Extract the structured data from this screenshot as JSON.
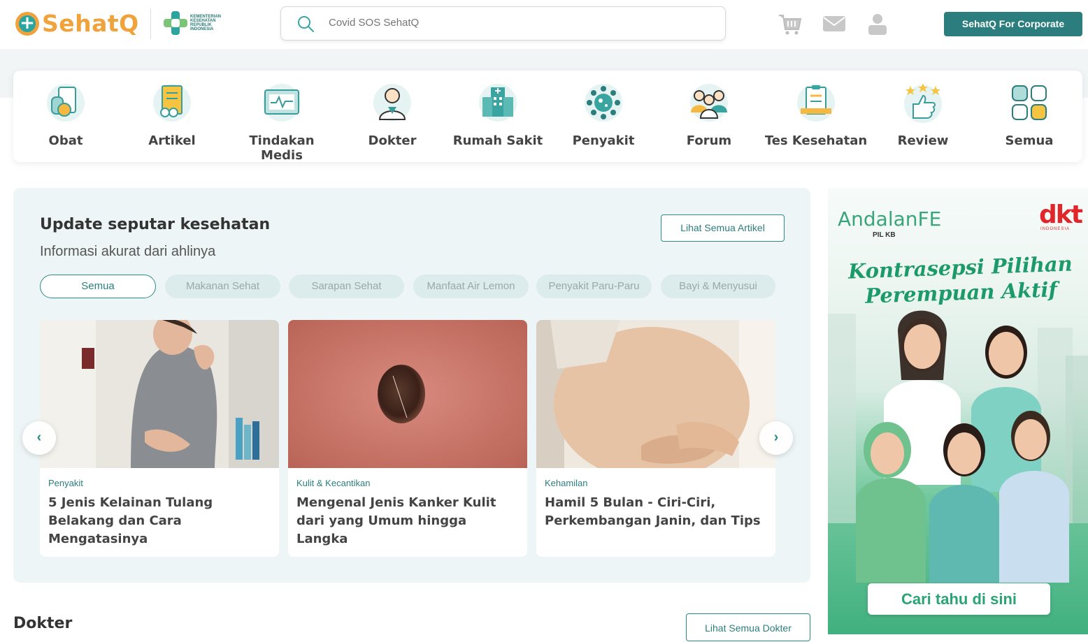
{
  "header": {
    "logo_text": "SehatQ",
    "kemenkes_text": "KEMENTERIAN KESEHATAN REPUBLIK INDONESIA",
    "search_placeholder": "Covid SOS SehatQ",
    "icons": [
      "cart-icon",
      "mail-icon",
      "user-icon"
    ],
    "corporate_button": "SehatQ For Corporate"
  },
  "categories": [
    {
      "label": "Obat",
      "icon": "medicine-icon"
    },
    {
      "label": "Artikel",
      "icon": "article-icon"
    },
    {
      "label": "Tindakan Medis",
      "icon": "medical-procedure-icon"
    },
    {
      "label": "Dokter",
      "icon": "doctor-icon"
    },
    {
      "label": "Rumah Sakit",
      "icon": "hospital-icon"
    },
    {
      "label": "Penyakit",
      "icon": "virus-icon"
    },
    {
      "label": "Forum",
      "icon": "forum-icon"
    },
    {
      "label": "Tes Kesehatan",
      "icon": "health-test-icon"
    },
    {
      "label": "Review",
      "icon": "review-icon"
    },
    {
      "label": "Semua",
      "icon": "grid-icon"
    }
  ],
  "articles": {
    "title": "Update seputar kesehatan",
    "subtitle": "Informasi akurat dari ahlinya",
    "see_all": "Lihat Semua Artikel",
    "chips": [
      "Semua",
      "Makanan Sehat",
      "Sarapan Sehat",
      "Manfaat Air Lemon",
      "Penyakit Paru-Paru",
      "Bayi & Menyusui"
    ],
    "active_chip": "Semua",
    "cards": [
      {
        "category": "Penyakit",
        "title": "5 Jenis Kelainan Tulang Belakang dan Cara Mengatasinya"
      },
      {
        "category": "Kulit & Kecantikan",
        "title": "Mengenal Jenis Kanker Kulit dari yang Umum hingga Langka"
      },
      {
        "category": "Kehamilan",
        "title": "Hamil 5 Bulan - Ciri-Ciri, Perkembangan Janin, dan Tips"
      }
    ],
    "prev_arrow": "‹",
    "next_arrow": "›"
  },
  "doctors": {
    "title": "Dokter",
    "see_all": "Lihat Semua Dokter"
  },
  "ad": {
    "brand": "AndalanFE",
    "brand_sub": "PIL KB",
    "sponsor": "dkt",
    "sponsor_sub": "INDONESIA",
    "headline": "Kontrasepsi Pilihan Perempuan Aktif",
    "cta": "Cari tahu di sini"
  },
  "colors": {
    "primary": "#2b7e7d",
    "accent": "#f0a23b",
    "chip_bg": "#dcebeb"
  }
}
